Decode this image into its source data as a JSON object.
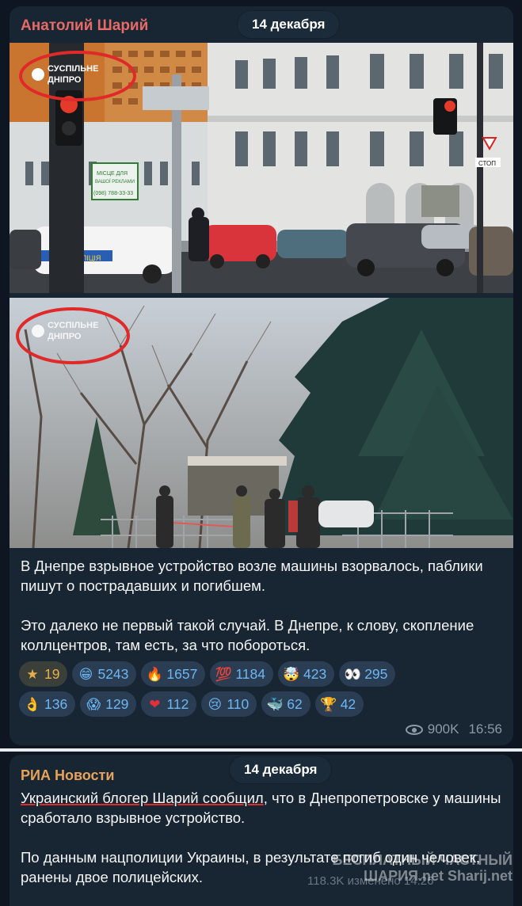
{
  "post1": {
    "author": "Анатолий Шарий",
    "date": "14 декабря",
    "photo1": {
      "logo_line1": "СУСПІЛЬНЕ",
      "logo_line2": "ДНІПРО",
      "sign_line1": "МІСЦЕ ДЛЯ",
      "sign_line2": "ВАШОЇ РЕКЛАМИ",
      "sign_phone": "(098) 788-33-33",
      "police_text": "ПОЛІЦІЯ",
      "stop_text": "СТОП"
    },
    "photo2": {
      "logo_line1": "СУСПІЛЬНЕ",
      "logo_line2": "ДНІПРО"
    },
    "text_p1": "В Днепре взрывное устройство возле машины взорвалось, паблики пишут о пострадавших и погибшем.",
    "text_p2": "Это далеко не первый такой случай. В Днепре, к слову, скопление коллцентров, там есть, за что побороться.",
    "reactions_row1": [
      {
        "emoji": "★",
        "emoji_name": "star",
        "count": "19",
        "color": "#e8b04c"
      },
      {
        "emoji": "😁",
        "emoji_name": "grinning-face",
        "count": "5243"
      },
      {
        "emoji": "🔥",
        "emoji_name": "fire",
        "count": "1657"
      },
      {
        "emoji": "💯",
        "emoji_name": "hundred-points",
        "count": "1184"
      },
      {
        "emoji": "🤯",
        "emoji_name": "exploding-head",
        "count": "423"
      },
      {
        "emoji": "👀",
        "emoji_name": "eyes",
        "count": "295"
      }
    ],
    "reactions_row2": [
      {
        "emoji": "👌",
        "emoji_name": "ok-hand",
        "count": "136"
      },
      {
        "emoji": "😱",
        "emoji_name": "screaming-face",
        "count": "129"
      },
      {
        "emoji": "❤",
        "emoji_name": "red-heart",
        "count": "112"
      },
      {
        "emoji": "😢",
        "emoji_name": "crying-face",
        "count": "110"
      },
      {
        "emoji": "🐳",
        "emoji_name": "whale",
        "count": "62"
      },
      {
        "emoji": "🏆",
        "emoji_name": "trophy",
        "count": "42"
      }
    ],
    "views": "900K",
    "time": "16:56"
  },
  "post2": {
    "author": "РИА Новости",
    "date": "14 декабря",
    "text_underlined": "Украинский блогер Шарий сообщил",
    "text_p1_rest": ", что в Днепропетровске у машины сработало взрывное устройство.",
    "text_p2": "По данным нацполиции Украины, в результате погиб один человек, ранены двое полицейских.",
    "meta": "118.3K изменено 14:26"
  },
  "watermark": {
    "line1": "БЕСПЛАТНЫЙ ЧАСТНЫЙ",
    "line2": "ШАРИЯ.net Sharij.net"
  },
  "colors": {
    "background": "#0e1621",
    "bubble": "#182533",
    "author1": "#e66b66",
    "author2": "#e8a35a",
    "reaction_count": "#6cb7f4",
    "annotation_red": "#e02a2a"
  }
}
